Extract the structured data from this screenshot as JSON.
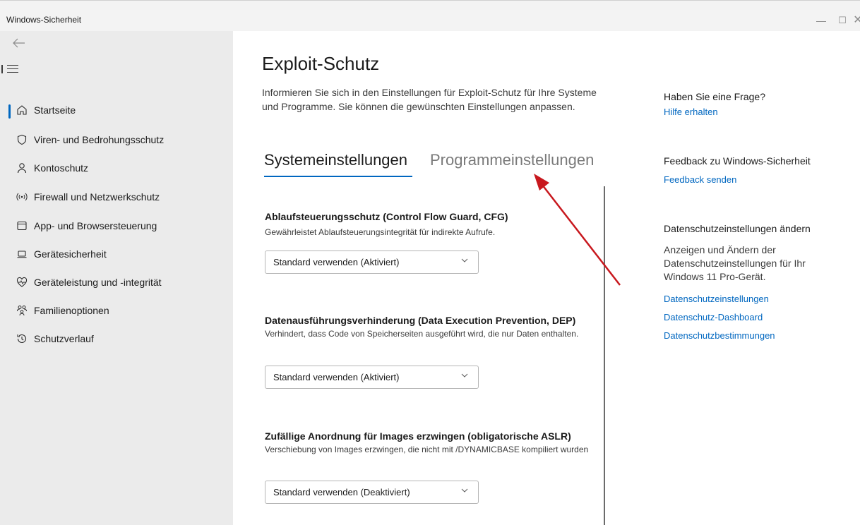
{
  "window": {
    "title": "Windows-Sicherheit",
    "controls": {
      "minimize": "—",
      "maximize": "☐",
      "close": "✕"
    }
  },
  "sidebar": {
    "back_icon": "back-arrow-icon",
    "menu_icon": "hamburger-icon",
    "items": [
      {
        "label": "Startseite",
        "icon": "home-icon",
        "selected": true
      },
      {
        "label": "Viren- und Bedrohungsschutz",
        "icon": "shield-icon"
      },
      {
        "label": "Kontoschutz",
        "icon": "person-icon"
      },
      {
        "label": "Firewall und Netzwerkschutz",
        "icon": "wifi-antenna-icon"
      },
      {
        "label": "App- und Browsersteuerung",
        "icon": "browser-window-icon"
      },
      {
        "label": "Gerätesicherheit",
        "icon": "laptop-icon"
      },
      {
        "label": "Geräteleistung und -integrität",
        "icon": "heart-pulse-icon"
      },
      {
        "label": "Familienoptionen",
        "icon": "family-icon"
      },
      {
        "label": "Schutzverlauf",
        "icon": "history-icon"
      }
    ]
  },
  "main": {
    "title": "Exploit-Schutz",
    "intro": "Informieren Sie sich in den Einstellungen für Exploit-Schutz für Ihre Systeme und Programme. Sie können die gewünschten Einstellungen anpassen.",
    "tabs": [
      {
        "label": "Systemeinstellungen",
        "active": true
      },
      {
        "label": "Programmeinstellungen",
        "active": false
      }
    ],
    "settings": [
      {
        "title": "Ablaufsteuerungsschutz (Control Flow Guard, CFG)",
        "description": "Gewährleistet Ablaufsteuerungsintegrität für indirekte Aufrufe.",
        "value": "Standard verwenden (Aktiviert)"
      },
      {
        "title": "Datenausführungsverhinderung (Data Execution Prevention, DEP)",
        "description": "Verhindert, dass Code von Speicherseiten ausgeführt wird, die nur Daten enthalten.",
        "value": "Standard verwenden (Aktiviert)"
      },
      {
        "title": "Zufällige Anordnung für Images erzwingen (obligatorische ASLR)",
        "description": "Verschiebung von Images erzwingen, die nicht mit /DYNAMICBASE kompiliert wurden",
        "value": "Standard verwenden (Deaktiviert)"
      }
    ]
  },
  "right_panel": {
    "question_heading": "Haben Sie eine Frage?",
    "help_link": "Hilfe erhalten",
    "feedback_heading": "Feedback zu Windows-Sicherheit",
    "feedback_link": "Feedback senden",
    "privacy_heading": "Datenschutzeinstellungen ändern",
    "privacy_text": "Anzeigen und Ändern der Datenschutzeinstellungen für Ihr Windows 11 Pro-Gerät.",
    "privacy_links": [
      "Datenschutzeinstellungen",
      "Datenschutz-Dashboard",
      "Datenschutzbestimmungen"
    ]
  },
  "colors": {
    "accent": "#0067c0",
    "annotation_arrow": "#c8181e",
    "sidebar_bg": "#ebebeb"
  }
}
